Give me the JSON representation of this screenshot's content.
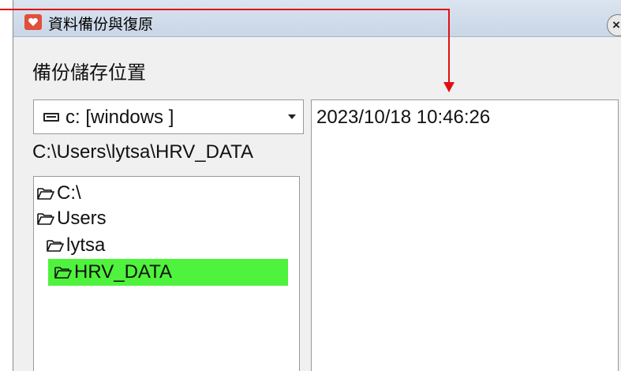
{
  "window": {
    "title": "資料備份與復原",
    "close_glyph": "×"
  },
  "storage": {
    "section_label": "備份儲存位置",
    "drive_selected": "c: [windows ]",
    "current_path": "C:\\Users\\lytsa\\HRV_DATA"
  },
  "folder_tree": {
    "items": [
      {
        "label": "C:\\",
        "selected": false
      },
      {
        "label": "Users",
        "selected": false
      },
      {
        "label": "lytsa",
        "selected": false
      },
      {
        "label": "HRV_DATA",
        "selected": true
      }
    ]
  },
  "backups": {
    "items": [
      "2023/10/18 10:46:26"
    ]
  },
  "colors": {
    "selection": "#4ff23c",
    "annotation": "#e01010",
    "app_icon": "#e0503a"
  },
  "icons": {
    "app": "heart-app-icon",
    "drive": "hard-drive-icon",
    "folder": "open-folder-icon",
    "dropdown": "chevron-down-icon",
    "close": "close-icon"
  }
}
